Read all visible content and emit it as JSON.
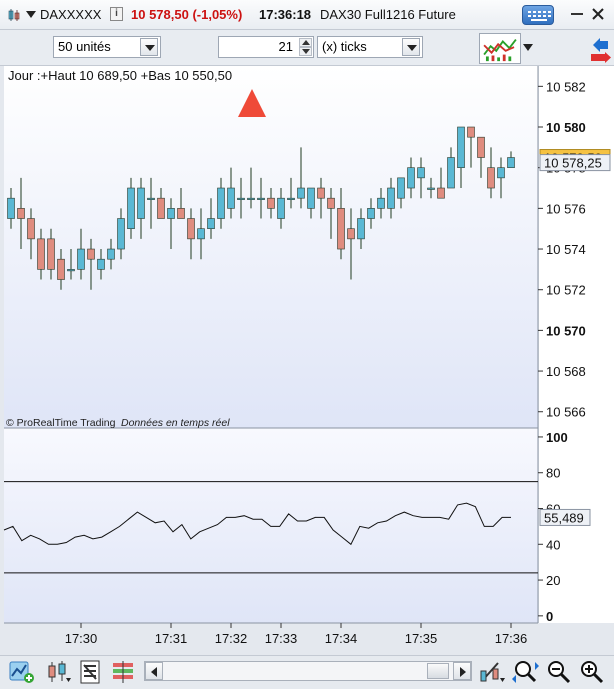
{
  "titlebar": {
    "instrument": "DAXXXXX",
    "price": "10 578,50 (-1,05%)",
    "time": "17:36:18",
    "description": "DAX30 Full1216 Future"
  },
  "controls": {
    "units_value": "50 unités",
    "ticks_count": "21",
    "ticks_unit": "(x) ticks"
  },
  "colors": {
    "up_candle": "#5ab8d4",
    "down_candle": "#df8c7f",
    "price_label_bg": "#f5c242",
    "price_down_text": "#cc1111",
    "alert_arrow": "#ef4a38"
  },
  "chart_data": [
    {
      "type": "candlestick",
      "panel": "price",
      "header": "Jour :+Haut 10 689,50 +Bas 10 550,50",
      "ylim": [
        10565.2,
        10583.0
      ],
      "y_ticks": [
        "10 582",
        "10 580",
        "10 578",
        "10 576",
        "10 574",
        "10 572",
        "10 570",
        "10 568",
        "10 566"
      ],
      "y_ticks_bold": [
        "10 580",
        "10 570"
      ],
      "current_price_label": "10 578,50",
      "second_price_label": "10 578,25",
      "footer_source": "© ProRealTime Trading",
      "footer_note": "Données en temps réel",
      "x_tick_labels": [
        "17:30",
        "17:31",
        "17:32",
        "17:33",
        "17:34",
        "17:35",
        "17:36"
      ],
      "candles": [
        {
          "o": 10575.5,
          "h": 10577.0,
          "l": 10575.0,
          "c": 10576.5
        },
        {
          "o": 10576.0,
          "h": 10577.5,
          "l": 10574.0,
          "c": 10575.5
        },
        {
          "o": 10575.5,
          "h": 10576.0,
          "l": 10573.5,
          "c": 10574.5
        },
        {
          "o": 10574.5,
          "h": 10575.0,
          "l": 10572.5,
          "c": 10573.0
        },
        {
          "o": 10574.5,
          "h": 10575.0,
          "l": 10572.5,
          "c": 10573.0
        },
        {
          "o": 10573.5,
          "h": 10574.0,
          "l": 10572.0,
          "c": 10572.5
        },
        {
          "o": 10573.0,
          "h": 10574.0,
          "l": 10572.5,
          "c": 10573.0
        },
        {
          "o": 10573.0,
          "h": 10575.0,
          "l": 10572.5,
          "c": 10574.0
        },
        {
          "o": 10574.0,
          "h": 10574.5,
          "l": 10572.0,
          "c": 10573.5
        },
        {
          "o": 10573.0,
          "h": 10574.0,
          "l": 10572.5,
          "c": 10573.5
        },
        {
          "o": 10573.5,
          "h": 10574.5,
          "l": 10573.0,
          "c": 10574.0
        },
        {
          "o": 10574.0,
          "h": 10576.0,
          "l": 10573.5,
          "c": 10575.5
        },
        {
          "o": 10575.0,
          "h": 10577.5,
          "l": 10574.5,
          "c": 10577.0
        },
        {
          "o": 10575.5,
          "h": 10577.5,
          "l": 10574.5,
          "c": 10577.0
        },
        {
          "o": 10576.5,
          "h": 10577.5,
          "l": 10575.0,
          "c": 10576.5
        },
        {
          "o": 10576.5,
          "h": 10577.0,
          "l": 10575.5,
          "c": 10575.5
        },
        {
          "o": 10575.5,
          "h": 10576.5,
          "l": 10574.0,
          "c": 10576.0
        },
        {
          "o": 10576.0,
          "h": 10577.0,
          "l": 10575.5,
          "c": 10575.5
        },
        {
          "o": 10575.5,
          "h": 10576.0,
          "l": 10573.5,
          "c": 10574.5
        },
        {
          "o": 10574.5,
          "h": 10576.0,
          "l": 10573.5,
          "c": 10575.0
        },
        {
          "o": 10575.0,
          "h": 10576.5,
          "l": 10574.5,
          "c": 10575.5
        },
        {
          "o": 10575.5,
          "h": 10577.5,
          "l": 10575.0,
          "c": 10577.0
        },
        {
          "o": 10576.0,
          "h": 10578.0,
          "l": 10575.5,
          "c": 10577.0
        },
        {
          "o": 10576.5,
          "h": 10577.5,
          "l": 10575.5,
          "c": 10576.5
        },
        {
          "o": 10576.5,
          "h": 10578.0,
          "l": 10576.0,
          "c": 10576.5
        },
        {
          "o": 10576.5,
          "h": 10577.5,
          "l": 10575.5,
          "c": 10576.5
        },
        {
          "o": 10576.5,
          "h": 10577.0,
          "l": 10575.5,
          "c": 10576.0
        },
        {
          "o": 10575.5,
          "h": 10577.0,
          "l": 10575.0,
          "c": 10576.5
        },
        {
          "o": 10576.5,
          "h": 10577.5,
          "l": 10576.0,
          "c": 10576.5
        },
        {
          "o": 10576.5,
          "h": 10579.0,
          "l": 10576.0,
          "c": 10577.0
        },
        {
          "o": 10576.0,
          "h": 10577.0,
          "l": 10575.5,
          "c": 10577.0
        },
        {
          "o": 10577.0,
          "h": 10577.5,
          "l": 10575.5,
          "c": 10576.5
        },
        {
          "o": 10576.5,
          "h": 10577.0,
          "l": 10574.5,
          "c": 10576.0
        },
        {
          "o": 10576.0,
          "h": 10577.0,
          "l": 10573.5,
          "c": 10574.0
        },
        {
          "o": 10575.0,
          "h": 10576.0,
          "l": 10572.5,
          "c": 10574.5
        },
        {
          "o": 10574.5,
          "h": 10576.0,
          "l": 10574.0,
          "c": 10575.5
        },
        {
          "o": 10575.5,
          "h": 10576.5,
          "l": 10575.0,
          "c": 10576.0
        },
        {
          "o": 10576.0,
          "h": 10577.0,
          "l": 10575.5,
          "c": 10576.5
        },
        {
          "o": 10576.0,
          "h": 10577.5,
          "l": 10575.5,
          "c": 10577.0
        },
        {
          "o": 10576.5,
          "h": 10577.5,
          "l": 10576.0,
          "c": 10577.5
        },
        {
          "o": 10577.0,
          "h": 10578.5,
          "l": 10576.5,
          "c": 10578.0
        },
        {
          "o": 10577.5,
          "h": 10578.5,
          "l": 10576.5,
          "c": 10578.0
        },
        {
          "o": 10577.0,
          "h": 10577.5,
          "l": 10576.5,
          "c": 10577.0
        },
        {
          "o": 10577.0,
          "h": 10578.0,
          "l": 10576.5,
          "c": 10576.5
        },
        {
          "o": 10577.0,
          "h": 10579.0,
          "l": 10577.0,
          "c": 10578.5
        },
        {
          "o": 10578.0,
          "h": 10580.0,
          "l": 10577.0,
          "c": 10580.0
        },
        {
          "o": 10580.0,
          "h": 10580.0,
          "l": 10578.0,
          "c": 10579.5
        },
        {
          "o": 10579.5,
          "h": 10579.5,
          "l": 10577.5,
          "c": 10578.5
        },
        {
          "o": 10578.0,
          "h": 10579.0,
          "l": 10576.5,
          "c": 10577.0
        },
        {
          "o": 10577.5,
          "h": 10578.5,
          "l": 10576.5,
          "c": 10578.0
        },
        {
          "o": 10578.0,
          "h": 10578.8,
          "l": 10578.0,
          "c": 10578.5
        }
      ]
    },
    {
      "type": "line",
      "panel": "oscillator",
      "ylim": [
        -4.0,
        105.0
      ],
      "y_ticks": [
        "100",
        "80",
        "60",
        "40",
        "20",
        "0"
      ],
      "y_ticks_bold": [
        "100",
        "0"
      ],
      "levels": [
        75,
        24
      ],
      "current_value_label": "55,489",
      "values": [
        48,
        50,
        42,
        45,
        43,
        40,
        40,
        41,
        44,
        45,
        43,
        44,
        47,
        50,
        54,
        58,
        55,
        52,
        53,
        47,
        51,
        43,
        47,
        49,
        51,
        55,
        55,
        56,
        54,
        54,
        50,
        50,
        57,
        53,
        53,
        55,
        55,
        48,
        44,
        40,
        50,
        49,
        52,
        53,
        56,
        58,
        56,
        55,
        55,
        55,
        54,
        62,
        63,
        61,
        50,
        50,
        55,
        55
      ]
    }
  ],
  "bottombar": {
    "icons": [
      "indicator-add-icon",
      "candles-style-icon",
      "list-sheet-icon",
      "bars-style-icon",
      "drawing-tools-icon",
      "zoom-fit-icon",
      "zoom-out-icon",
      "zoom-in-icon"
    ]
  }
}
